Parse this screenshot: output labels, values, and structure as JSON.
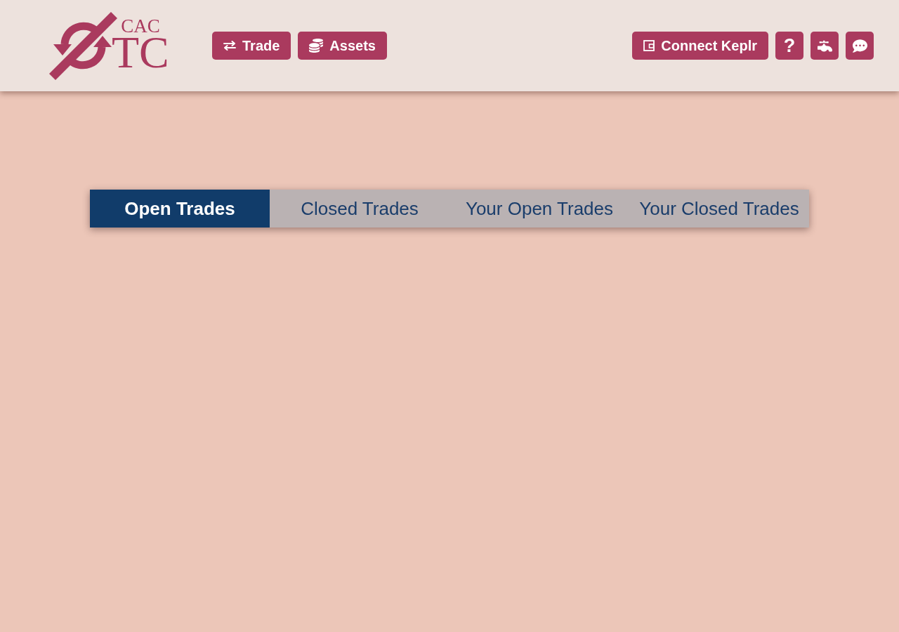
{
  "header": {
    "logo": {
      "top_text": "CAC",
      "main_text": "TC"
    },
    "nav": [
      {
        "kind": "exchange",
        "label": "Trade"
      },
      {
        "kind": "coins",
        "label": "Assets"
      }
    ],
    "actions": [
      {
        "kind": "wallet",
        "label": "Connect Keplr"
      },
      {
        "kind": "text",
        "label": "?"
      },
      {
        "kind": "faucet"
      },
      {
        "kind": "chat"
      }
    ]
  },
  "tabs": [
    {
      "label": "Open Trades",
      "selected": true
    },
    {
      "label": "Closed Trades",
      "selected": false
    },
    {
      "label": "Your Open Trades",
      "selected": false
    },
    {
      "label": "Your Closed Trades",
      "selected": false
    }
  ]
}
